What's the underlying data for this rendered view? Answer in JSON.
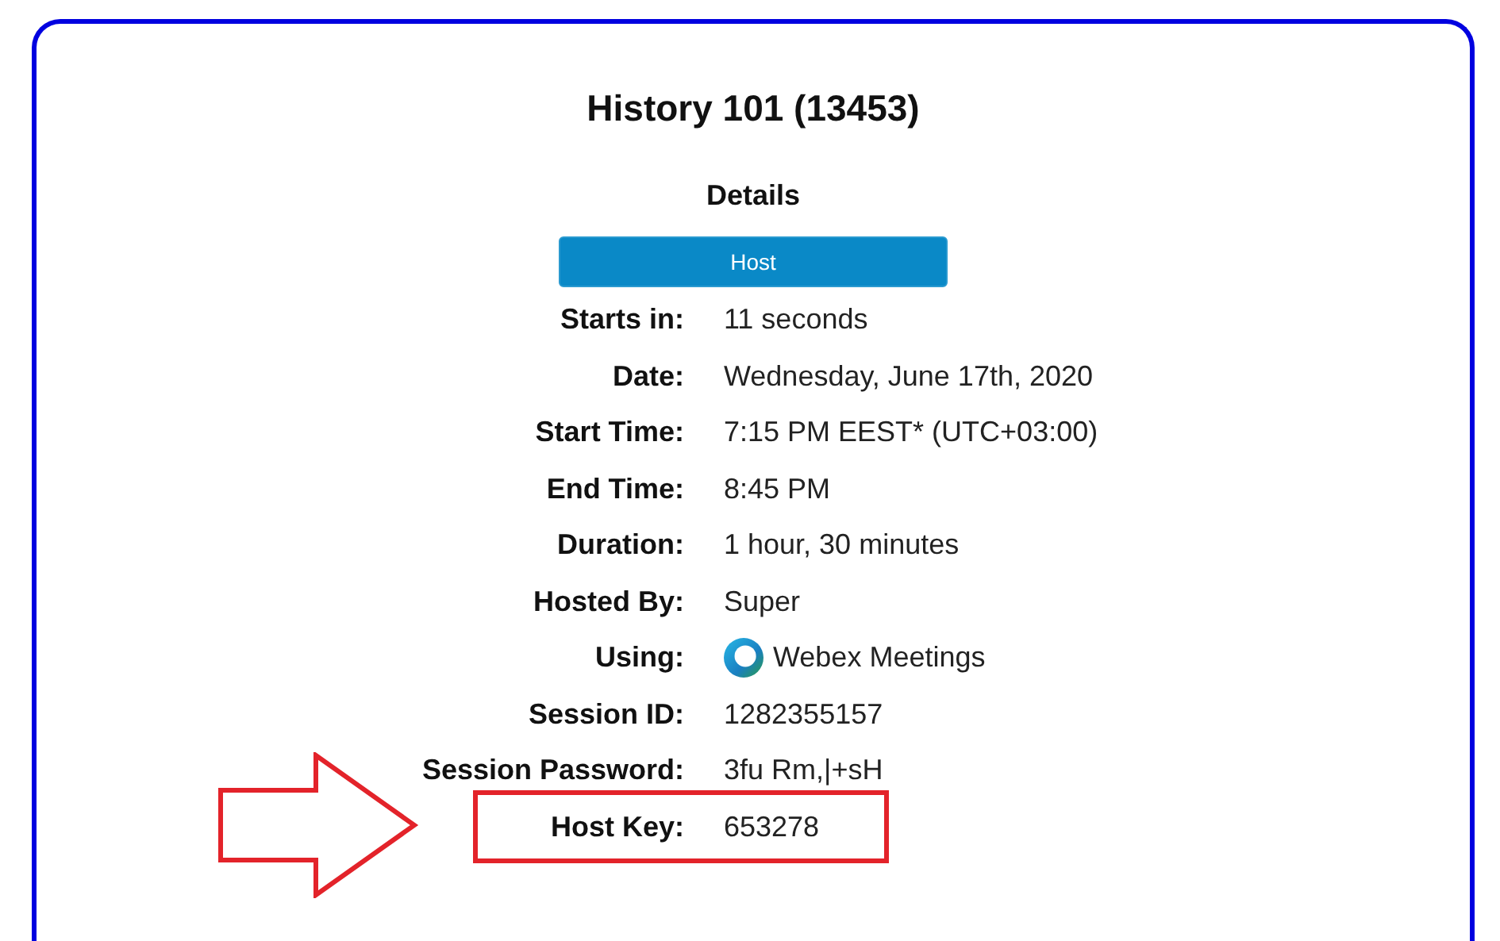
{
  "title": "History 101 (13453)",
  "subtitle": "Details",
  "button": "Host",
  "rows": [
    {
      "label": "Starts in:",
      "value": "11 seconds",
      "highlighted": false
    },
    {
      "label": "Date:",
      "value": "Wednesday, June 17th, 2020",
      "highlighted": false
    },
    {
      "label": "Start Time:",
      "value": "7:15 PM EEST* (UTC+03:00)",
      "highlighted": false
    },
    {
      "label": "End Time:",
      "value": "8:45 PM",
      "highlighted": false
    },
    {
      "label": "Duration:",
      "value": "1 hour, 30 minutes",
      "highlighted": false
    },
    {
      "label": "Hosted By:",
      "value": "Super",
      "highlighted": false
    },
    {
      "label": "Using:",
      "value": "Webex Meetings",
      "kind": "app",
      "highlighted": false
    },
    {
      "label": "Session ID:",
      "value": "1282355157",
      "highlighted": false
    },
    {
      "label": "Session Password:",
      "value": "3fu Rm,|+sH",
      "highlighted": false
    },
    {
      "label": "Host Key:",
      "value": "653278",
      "highlighted": true
    }
  ]
}
